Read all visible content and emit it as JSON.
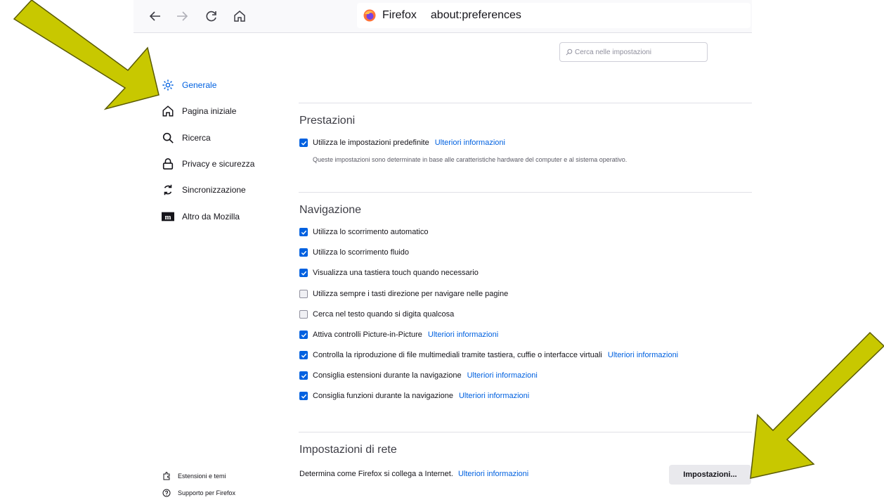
{
  "browser": {
    "brand": "Firefox",
    "url": "about:preferences",
    "icons": [
      "back-icon",
      "forward-icon",
      "reload-icon",
      "home-icon",
      "firefox-logo-icon"
    ]
  },
  "search": {
    "placeholder": "Cerca nelle impostazioni"
  },
  "sidebar": {
    "items": [
      {
        "label": "Generale",
        "icon": "gear-icon",
        "active": true
      },
      {
        "label": "Pagina iniziale",
        "icon": "home-icon"
      },
      {
        "label": "Ricerca",
        "icon": "search-icon"
      },
      {
        "label": "Privacy e sicurezza",
        "icon": "lock-icon"
      },
      {
        "label": "Sincronizzazione",
        "icon": "sync-icon"
      },
      {
        "label": "Altro da Mozilla",
        "icon": "mozilla-icon"
      }
    ],
    "footer": [
      {
        "label": "Estensioni e temi",
        "icon": "puzzle-icon"
      },
      {
        "label": "Supporto per Firefox",
        "icon": "help-icon"
      }
    ]
  },
  "performance": {
    "title": "Prestazioni",
    "option": {
      "label": "Utilizza le impostazioni predefinite",
      "link": "Ulteriori informazioni",
      "checked": true
    },
    "description": "Queste impostazioni sono determinate in base alle caratteristiche hardware del computer e al sistema operativo."
  },
  "navigation": {
    "title": "Navigazione",
    "options": [
      {
        "label": "Utilizza lo scorrimento automatico",
        "checked": true,
        "link": ""
      },
      {
        "label": "Utilizza lo scorrimento fluido",
        "checked": true,
        "link": ""
      },
      {
        "label": "Visualizza una tastiera touch quando necessario",
        "checked": true,
        "link": ""
      },
      {
        "label": "Utilizza sempre i tasti direzione per navigare nelle pagine",
        "checked": false,
        "link": ""
      },
      {
        "label": "Cerca nel testo quando si digita qualcosa",
        "checked": false,
        "link": ""
      },
      {
        "label": "Attiva controlli Picture-in-Picture",
        "checked": true,
        "link": "Ulteriori informazioni"
      },
      {
        "label": "Controlla la riproduzione di file multimediali tramite tastiera, cuffie o interfacce virtuali",
        "checked": true,
        "link": "Ulteriori informazioni"
      },
      {
        "label": "Consiglia estensioni durante la navigazione",
        "checked": true,
        "link": "Ulteriori informazioni"
      },
      {
        "label": "Consiglia funzioni durante la navigazione",
        "checked": true,
        "link": "Ulteriori informazioni"
      }
    ]
  },
  "network": {
    "title": "Impostazioni di rete",
    "description": "Determina come Firefox si collega a Internet.",
    "link": "Ulteriori informazioni",
    "button": "Impostazioni..."
  },
  "annotations": {
    "arrow_color": "#c8c800",
    "arrow_outline": "#5a5a00"
  }
}
